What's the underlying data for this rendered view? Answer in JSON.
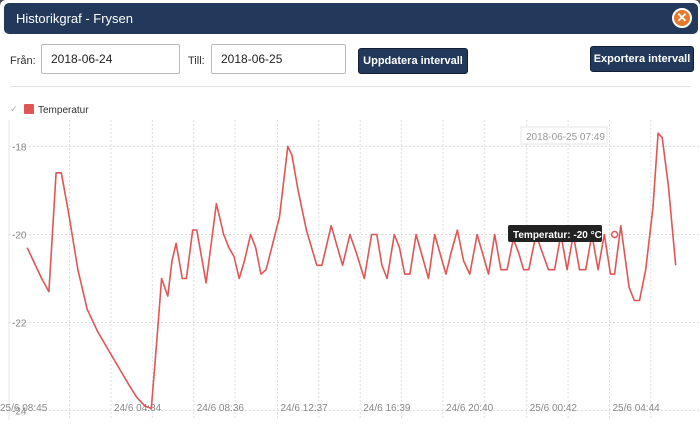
{
  "window": {
    "title": "Historikgraf - Frysen",
    "close_symbol": "✕"
  },
  "toolbar": {
    "from_label": "Från:",
    "from_value": "2018-06-24",
    "to_label": "Till:",
    "to_value": "2018-06-25",
    "update_button": "Uppdatera intervall",
    "export_button": "Exportera intervall"
  },
  "legend": {
    "check": "✓",
    "series_name": "Temperatur"
  },
  "tooltip": {
    "header": "2018-06-25 07:49",
    "text": "Temperatur: -20 °C"
  },
  "chart_data": {
    "type": "line",
    "series": [
      {
        "name": "Temperatur",
        "color": "#e05555",
        "points": [
          [
            0,
            -20.3
          ],
          [
            0.6,
            -20.6
          ],
          [
            1.4,
            -21.0
          ],
          [
            2.1,
            -21.3
          ],
          [
            2.8,
            -18.6
          ],
          [
            3.3,
            -18.6
          ],
          [
            4.0,
            -19.5
          ],
          [
            4.9,
            -20.8
          ],
          [
            5.8,
            -21.7
          ],
          [
            6.8,
            -22.2
          ],
          [
            7.8,
            -22.6
          ],
          [
            8.8,
            -23.0
          ],
          [
            9.8,
            -23.4
          ],
          [
            10.6,
            -23.7
          ],
          [
            11.4,
            -23.9
          ],
          [
            12.0,
            -23.95
          ],
          [
            12.5,
            -22.5
          ],
          [
            13.0,
            -21.0
          ],
          [
            13.6,
            -21.4
          ],
          [
            14.0,
            -20.6
          ],
          [
            14.4,
            -20.2
          ],
          [
            15.0,
            -21.0
          ],
          [
            15.4,
            -21.0
          ],
          [
            16.0,
            -19.9
          ],
          [
            16.4,
            -19.9
          ],
          [
            17.3,
            -21.1
          ],
          [
            18.3,
            -19.3
          ],
          [
            19.0,
            -20.0
          ],
          [
            19.5,
            -20.3
          ],
          [
            20.0,
            -20.5
          ],
          [
            20.5,
            -21.0
          ],
          [
            21.0,
            -20.6
          ],
          [
            21.6,
            -20.0
          ],
          [
            22.1,
            -20.3
          ],
          [
            22.6,
            -20.9
          ],
          [
            23.1,
            -20.8
          ],
          [
            24.4,
            -19.6
          ],
          [
            25.2,
            -18.0
          ],
          [
            25.6,
            -18.2
          ],
          [
            26.2,
            -19.0
          ],
          [
            27.0,
            -19.9
          ],
          [
            28.0,
            -20.7
          ],
          [
            28.5,
            -20.7
          ],
          [
            29.4,
            -19.8
          ],
          [
            30.0,
            -20.3
          ],
          [
            30.5,
            -20.7
          ],
          [
            31.2,
            -20.0
          ],
          [
            31.8,
            -20.4
          ],
          [
            32.6,
            -21.0
          ],
          [
            33.3,
            -20.0
          ],
          [
            33.8,
            -20.0
          ],
          [
            34.3,
            -20.7
          ],
          [
            34.8,
            -21.0
          ],
          [
            35.5,
            -20.0
          ],
          [
            36.0,
            -20.3
          ],
          [
            36.5,
            -20.9
          ],
          [
            37.0,
            -20.9
          ],
          [
            37.6,
            -20.0
          ],
          [
            38.2,
            -20.5
          ],
          [
            38.8,
            -21.0
          ],
          [
            39.4,
            -20.0
          ],
          [
            40.0,
            -20.5
          ],
          [
            40.5,
            -20.9
          ],
          [
            41.0,
            -20.4
          ],
          [
            41.6,
            -19.9
          ],
          [
            42.2,
            -20.6
          ],
          [
            42.8,
            -20.9
          ],
          [
            43.5,
            -20.0
          ],
          [
            44.0,
            -20.4
          ],
          [
            44.6,
            -20.9
          ],
          [
            45.2,
            -20.0
          ],
          [
            45.8,
            -20.8
          ],
          [
            46.4,
            -20.8
          ],
          [
            47.0,
            -20.1
          ],
          [
            47.5,
            -20.4
          ],
          [
            48.0,
            -20.8
          ],
          [
            48.5,
            -20.8
          ],
          [
            49.2,
            -20.0
          ],
          [
            49.8,
            -20.4
          ],
          [
            50.4,
            -20.8
          ],
          [
            51.0,
            -20.8
          ],
          [
            51.6,
            -20.0
          ],
          [
            52.2,
            -20.8
          ],
          [
            52.8,
            -20.0
          ],
          [
            53.4,
            -20.8
          ],
          [
            54.0,
            -20.8
          ],
          [
            54.6,
            -20.0
          ],
          [
            55.2,
            -20.8
          ],
          [
            55.8,
            -20.0
          ],
          [
            56.4,
            -20.9
          ],
          [
            56.8,
            -20.9
          ],
          [
            57.4,
            -19.8
          ],
          [
            58.2,
            -21.2
          ],
          [
            58.7,
            -21.5
          ],
          [
            59.2,
            -21.5
          ],
          [
            59.8,
            -20.8
          ],
          [
            60.5,
            -19.4
          ],
          [
            61.0,
            -17.7
          ],
          [
            61.4,
            -17.8
          ],
          [
            62.0,
            -18.9
          ],
          [
            62.7,
            -20.7
          ]
        ]
      }
    ],
    "x_tick_labels": [
      "24/6 04:34",
      "24/6 08:36",
      "24/6 12:37",
      "24/6 16:39",
      "24/6 20:40",
      "25/6 00:42",
      "25/6 04:44",
      "25/6 08:45"
    ],
    "y_tick_labels": [
      "-18",
      "-20",
      "-22",
      "-24"
    ],
    "y_ticks": [
      -18,
      -20,
      -22,
      -24
    ],
    "xlim": [
      -0.5,
      63.7
    ],
    "ylim": [
      -24.1,
      -17.4
    ],
    "x_ticks": [
      4.1,
      8.1,
      12.1,
      16.1,
      20.1,
      24.2,
      28.2,
      32.2,
      36.2,
      40.2,
      44.2,
      48.3,
      52.3,
      56.3,
      60.3
    ],
    "x_label_every": 2,
    "x_label_offset": 1,
    "highlight_point": [
      56.8,
      -20.0
    ],
    "grid": true
  }
}
